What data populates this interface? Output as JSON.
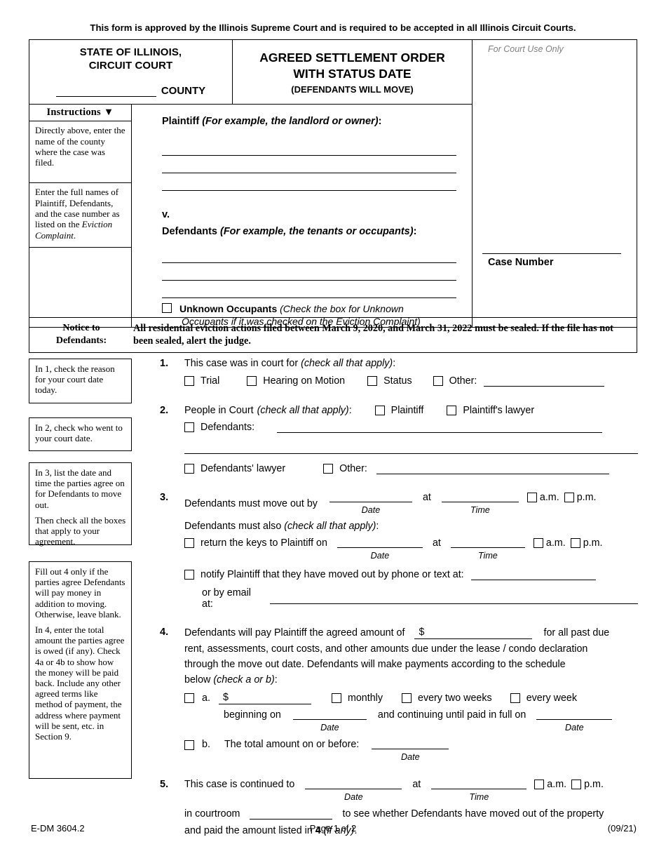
{
  "approval_note": "This form is approved by the Illinois Supreme Court and is required to be accepted in all Illinois Circuit Courts.",
  "header": {
    "state_line1": "STATE OF ILLINOIS,",
    "state_line2": "CIRCUIT COURT",
    "county_word": "COUNTY",
    "title_line1": "AGREED SETTLEMENT ORDER",
    "title_line2": "WITH STATUS DATE",
    "title_line3": "(DEFENDANTS WILL MOVE)",
    "court_use_only": "For Court Use Only",
    "case_number_label": "Case Number"
  },
  "instructions_panel": {
    "heading": "Instructions",
    "caret": "▼",
    "cells": [
      "Directly above, enter the name of the county where the case was filed.",
      "Enter the full names of Plaintiff, Defendants, and the case number as listed on the ",
      ""
    ],
    "cell2_italic": "Eviction Complaint",
    "cell2_tail": "."
  },
  "parties": {
    "plaintiff_label": "Plaintiff",
    "plaintiff_hint": "(For example, the landlord or owner)",
    "versus": "v.",
    "defendants_label": "Defendants",
    "defendants_hint": "(For example, the tenants or occupants)",
    "unknown_label": "Unknown Occupants",
    "unknown_hint_line1": "(Check the box for Unknown",
    "unknown_hint_line2": "Occupants if it was checked on the Eviction Complaint)"
  },
  "notice": {
    "label_line1": "Notice to",
    "label_line2": "Defendants:",
    "text": "All residential eviction actions filed between March 9, 2020, and March 31, 2022 must be sealed. If the file has not been sealed, alert the judge."
  },
  "side_notes": [
    {
      "paragraphs": [
        "In 1, check the reason for your court date today."
      ]
    },
    {
      "paragraphs": [
        "In 2, check who went to your court date."
      ]
    },
    {
      "paragraphs": [
        "In 3, list the date and time the parties agree on for Defendants to move out.",
        "Then check all the boxes that apply to your agreement."
      ]
    },
    {
      "paragraphs": [
        "Fill out 4 only if the parties agree Defendants will pay money in addition to moving. Otherwise, leave blank.",
        "In 4, enter the total amount the parties agree is owed (if any). Check 4a or 4b to show how the money will be paid back. Include any other agreed terms like method of payment, the address where payment will be sent, etc. in Section 9."
      ]
    }
  ],
  "items": {
    "item1": {
      "number": "1.",
      "lead": "This case was in court for",
      "lead_hint": "(check all that apply)",
      "colon": ":",
      "options": [
        "Trial",
        "Hearing on Motion",
        "Status",
        "Other:"
      ]
    },
    "item2": {
      "number": "2.",
      "lead": "People in Court",
      "lead_hint": "(check all that apply)",
      "colon": ":",
      "opt_plaintiff": "Plaintiff",
      "opt_plaintiff_lawyer": "Plaintiff's lawyer",
      "opt_defendants": "Defendants:",
      "opt_defendants_lawyer": "Defendants' lawyer",
      "opt_other": "Other:"
    },
    "item3": {
      "number": "3.",
      "line1": "Defendants must move out by",
      "at": "at",
      "date_cap": "Date",
      "time_cap": "Time",
      "am": "a.m.",
      "pm": "p.m.",
      "also_lead": "Defendants must also",
      "also_hint": "(check all that apply)",
      "also_colon": ":",
      "opt_keys": "return the keys to Plaintiff on",
      "opt_notify": "notify Plaintiff that they have moved out by phone or text at:",
      "opt_email": "or by email at:"
    },
    "item4": {
      "number": "4.",
      "text_a": "Defendants will pay Plaintiff the agreed amount of",
      "dollar": "$",
      "text_b": "for all past due",
      "text_c": "rent, assessments, court costs, and other amounts due under the lease / condo declaration",
      "text_d": "through the move out date. Defendants will make payments according to the schedule",
      "text_e": "below",
      "text_e_hint": "(check a or b)",
      "text_e_colon": ":",
      "a_letter": "a.",
      "a_dollar": "$",
      "a_monthly": "monthly",
      "a_biweekly": "every two weeks",
      "a_weekly": "every week",
      "a_beginning": "beginning on",
      "a_continuing": "and continuing until paid in full on",
      "date_cap": "Date",
      "b_letter": "b.",
      "b_text": "The total amount on or before:"
    },
    "item5": {
      "number": "5.",
      "line1": "This case is continued to",
      "at": "at",
      "date_cap": "Date",
      "time_cap": "Time",
      "am": "a.m.",
      "pm": "p.m.",
      "line2_a": "in courtroom",
      "line2_b": "to see whether Defendants have moved out of the property",
      "line3_a": "and paid the amount listed in",
      "line3_num": "4",
      "line3_hint": "(if any)",
      "line3_end": "."
    }
  },
  "footer": {
    "form_id": "E-DM 3604.2",
    "page": "Page 1 of 2",
    "revision": "(09/21)"
  }
}
